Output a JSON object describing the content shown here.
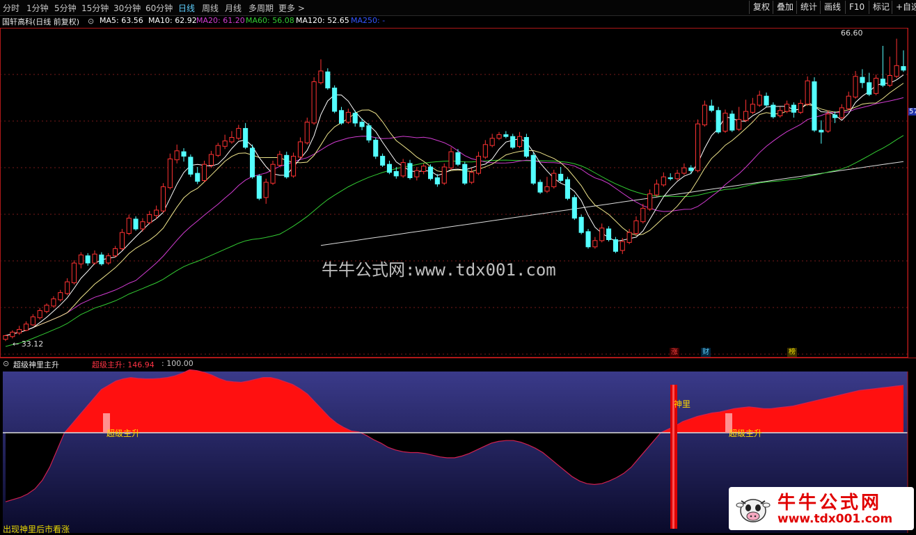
{
  "toolbar": {
    "periods": [
      "分时",
      "1分钟",
      "5分钟",
      "15分钟",
      "30分钟",
      "60分钟",
      "日线",
      "周线",
      "月线",
      "多周期",
      "更多 >"
    ],
    "active_period": "日线",
    "buttons": [
      "复权",
      "叠加",
      "统计",
      "画线",
      "F10",
      "标记",
      "+自选"
    ]
  },
  "stock": {
    "name": "国轩高科(日线 前复权)",
    "ma": [
      {
        "label": "MA5: 63.56",
        "color": "#ffffff"
      },
      {
        "label": "MA10: 62.92",
        "color": "#ffffff"
      },
      {
        "label": "MA20: 61.20",
        "color": "#d23cd2"
      },
      {
        "label": "MA60: 56.08",
        "color": "#33cc33"
      },
      {
        "label": "MA120: 52.65",
        "color": "#ffffff"
      },
      {
        "label": "MA250: -",
        "color": "#3355ff"
      }
    ],
    "high_label": "66.60",
    "low_label": "33.12",
    "price_axis_label": "57"
  },
  "colors": {
    "up": "#ff3232",
    "down": "#54ffff",
    "ma5": "#ffffff",
    "ma10": "#f0e68c",
    "ma20": "#d23cd2",
    "ma60": "#33cc33",
    "ma120": "#dddddd",
    "grid": "#7a1a1a",
    "frame": "#b01818"
  },
  "markers": [
    {
      "text": "涨",
      "color": "#ff4040"
    },
    {
      "text": "财",
      "color": "#5fd0ff"
    },
    {
      "text": "榜",
      "color": "#e8d800"
    }
  ],
  "indicator": {
    "name": "超级神里主升",
    "value_label": "超级主升: 146.94",
    "level_label": ": 100.00",
    "signal_label": "超级主升",
    "signal2_label": "超级主升",
    "shenli_label": "神里",
    "footer": "出现神里后市看涨"
  },
  "watermark": "牛牛公式网:www.tdx001.com",
  "logo": {
    "title": "牛牛公式网",
    "url": "www.tdx001.com"
  },
  "chart_data": {
    "type": "candlestick",
    "price_range": [
      33.12,
      66.6
    ],
    "candles": [
      [
        33.1,
        33.5,
        32.9,
        33.6
      ],
      [
        33.4,
        33.9,
        33.2,
        34.1
      ],
      [
        33.8,
        34.2,
        33.6,
        34.6
      ],
      [
        34.1,
        34.8,
        34.0,
        35.1
      ],
      [
        34.7,
        35.6,
        34.6,
        35.9
      ],
      [
        35.5,
        36.3,
        35.3,
        36.6
      ],
      [
        36.2,
        36.9,
        36.0,
        37.1
      ],
      [
        36.8,
        37.6,
        36.6,
        37.9
      ],
      [
        37.5,
        38.3,
        37.3,
        38.6
      ],
      [
        38.2,
        39.5,
        38.0,
        39.9
      ],
      [
        39.4,
        41.6,
        39.2,
        41.9
      ],
      [
        41.5,
        42.5,
        41.0,
        42.8
      ],
      [
        42.4,
        41.6,
        41.3,
        42.7
      ],
      [
        41.6,
        42.6,
        41.4,
        43.0
      ],
      [
        42.5,
        41.5,
        41.3,
        42.8
      ],
      [
        41.6,
        42.4,
        41.4,
        42.7
      ],
      [
        42.4,
        43.2,
        42.2,
        43.5
      ],
      [
        43.2,
        45.0,
        43.0,
        45.4
      ],
      [
        44.9,
        46.6,
        44.7,
        47.0
      ],
      [
        46.5,
        45.4,
        45.2,
        46.8
      ],
      [
        45.4,
        46.2,
        45.1,
        46.6
      ],
      [
        46.1,
        47.0,
        45.9,
        47.4
      ],
      [
        46.9,
        47.5,
        46.5,
        48.0
      ],
      [
        47.4,
        50.1,
        47.2,
        50.5
      ],
      [
        50.0,
        53.2,
        49.8,
        53.8
      ],
      [
        53.1,
        54.1,
        52.7,
        54.8
      ],
      [
        54.0,
        53.5,
        52.9,
        54.4
      ],
      [
        53.4,
        51.5,
        51.2,
        53.7
      ],
      [
        51.6,
        50.7,
        50.4,
        52.3
      ],
      [
        50.8,
        52.6,
        50.6,
        53.0
      ],
      [
        52.5,
        53.7,
        52.2,
        54.1
      ],
      [
        53.6,
        54.7,
        53.4,
        55.0
      ],
      [
        54.6,
        55.2,
        54.3,
        55.9
      ],
      [
        55.1,
        55.6,
        54.9,
        56.3
      ],
      [
        55.5,
        56.6,
        55.3,
        57.0
      ],
      [
        56.6,
        54.5,
        54.3,
        57.2
      ],
      [
        54.4,
        51.2,
        51.0,
        54.8
      ],
      [
        51.3,
        48.8,
        48.6,
        51.5
      ],
      [
        48.9,
        50.6,
        48.2,
        51.0
      ],
      [
        50.5,
        52.6,
        50.3,
        53.0
      ],
      [
        52.5,
        53.7,
        52.3,
        54.1
      ],
      [
        53.6,
        51.2,
        51.0,
        54.0
      ],
      [
        51.3,
        53.5,
        51.1,
        53.9
      ],
      [
        53.4,
        55.1,
        53.2,
        55.6
      ],
      [
        55.0,
        57.3,
        54.8,
        57.8
      ],
      [
        57.2,
        61.8,
        57.0,
        62.3
      ],
      [
        61.7,
        63.0,
        61.5,
        64.3
      ],
      [
        62.9,
        61.1,
        60.9,
        63.3
      ],
      [
        61.1,
        58.5,
        58.3,
        61.4
      ],
      [
        58.6,
        57.2,
        57.0,
        59.0
      ],
      [
        57.3,
        58.4,
        57.1,
        58.8
      ],
      [
        58.3,
        57.2,
        56.8,
        58.6
      ],
      [
        57.3,
        56.8,
        56.4,
        57.7
      ],
      [
        56.9,
        55.3,
        55.0,
        57.2
      ],
      [
        55.3,
        53.5,
        53.2,
        55.6
      ],
      [
        53.5,
        52.5,
        52.3,
        53.8
      ],
      [
        52.6,
        51.7,
        51.5,
        53.0
      ],
      [
        51.8,
        51.3,
        51.0,
        52.3
      ],
      [
        51.3,
        52.8,
        51.1,
        53.2
      ],
      [
        52.7,
        51.1,
        50.9,
        53.1
      ],
      [
        51.2,
        51.9,
        50.8,
        52.3
      ],
      [
        51.8,
        52.4,
        51.5,
        52.7
      ],
      [
        52.3,
        51.0,
        50.8,
        52.6
      ],
      [
        51.1,
        50.4,
        50.1,
        51.5
      ],
      [
        50.5,
        52.3,
        50.3,
        52.7
      ],
      [
        52.2,
        54.0,
        52.0,
        54.5
      ],
      [
        53.9,
        52.6,
        52.4,
        54.3
      ],
      [
        52.6,
        50.5,
        50.3,
        52.9
      ],
      [
        50.6,
        51.7,
        50.4,
        52.2
      ],
      [
        51.6,
        53.5,
        51.4,
        54.0
      ],
      [
        53.4,
        54.8,
        53.2,
        55.3
      ],
      [
        54.7,
        55.5,
        54.5,
        56.0
      ],
      [
        55.5,
        55.9,
        55.3,
        56.2
      ],
      [
        55.9,
        55.7,
        55.5,
        56.3
      ],
      [
        55.7,
        54.5,
        54.3,
        56.0
      ],
      [
        54.6,
        55.7,
        54.4,
        56.2
      ],
      [
        55.6,
        53.5,
        53.3,
        56.0
      ],
      [
        53.6,
        50.5,
        50.3,
        53.9
      ],
      [
        50.6,
        49.5,
        49.3,
        50.9
      ],
      [
        49.6,
        50.1,
        49.4,
        51.2
      ],
      [
        50.1,
        51.6,
        49.9,
        52.0
      ],
      [
        51.5,
        50.8,
        50.6,
        52.3
      ],
      [
        50.9,
        48.8,
        48.6,
        51.2
      ],
      [
        48.9,
        46.6,
        46.4,
        49.2
      ],
      [
        46.7,
        45.0,
        44.8,
        47.0
      ],
      [
        45.1,
        43.4,
        43.2,
        45.4
      ],
      [
        43.4,
        44.1,
        43.2,
        44.5
      ],
      [
        44.1,
        45.5,
        43.9,
        46.0
      ],
      [
        45.4,
        44.2,
        44.0,
        45.7
      ],
      [
        44.2,
        42.9,
        42.7,
        44.5
      ],
      [
        43.0,
        44.0,
        42.6,
        44.4
      ],
      [
        43.9,
        45.0,
        43.7,
        45.4
      ],
      [
        44.9,
        46.3,
        44.7,
        46.8
      ],
      [
        46.2,
        47.7,
        46.0,
        48.2
      ],
      [
        47.6,
        49.3,
        47.4,
        49.8
      ],
      [
        49.2,
        50.4,
        49.0,
        50.9
      ],
      [
        50.3,
        51.2,
        50.1,
        51.7
      ],
      [
        51.1,
        51.0,
        50.8,
        51.6
      ],
      [
        51.0,
        51.6,
        50.8,
        52.0
      ],
      [
        51.6,
        52.2,
        51.4,
        52.7
      ],
      [
        52.2,
        51.9,
        51.5,
        52.5
      ],
      [
        51.9,
        57.1,
        51.7,
        57.6
      ],
      [
        57.0,
        59.2,
        56.8,
        59.7
      ],
      [
        59.1,
        58.6,
        58.4,
        59.8
      ],
      [
        58.6,
        56.2,
        56.0,
        59.0
      ],
      [
        56.3,
        58.3,
        56.1,
        58.7
      ],
      [
        58.2,
        56.4,
        56.2,
        58.6
      ],
      [
        56.5,
        57.6,
        56.3,
        59.0
      ],
      [
        57.5,
        58.5,
        57.3,
        59.8
      ],
      [
        58.4,
        59.3,
        58.2,
        60.0
      ],
      [
        59.2,
        60.3,
        59.0,
        60.8
      ],
      [
        60.2,
        59.2,
        59.0,
        60.6
      ],
      [
        59.2,
        57.9,
        57.7,
        59.5
      ],
      [
        58.0,
        58.6,
        57.8,
        59.0
      ],
      [
        58.5,
        59.3,
        58.3,
        59.7
      ],
      [
        59.2,
        58.4,
        57.8,
        59.5
      ],
      [
        58.4,
        59.4,
        58.2,
        59.8
      ],
      [
        59.3,
        61.9,
        59.1,
        62.4
      ],
      [
        61.8,
        56.4,
        56.2,
        62.3
      ],
      [
        56.4,
        56.2,
        54.9,
        57.5
      ],
      [
        56.3,
        58.2,
        56.1,
        58.6
      ],
      [
        58.1,
        57.8,
        57.2,
        58.5
      ],
      [
        57.8,
        58.9,
        57.6,
        59.3
      ],
      [
        58.8,
        60.2,
        58.6,
        60.7
      ],
      [
        60.1,
        62.4,
        59.9,
        63.0
      ],
      [
        62.3,
        61.7,
        61.1,
        63.2
      ],
      [
        61.7,
        60.4,
        60.2,
        62.8
      ],
      [
        60.5,
        62.2,
        60.3,
        62.6
      ],
      [
        62.1,
        61.4,
        61.2,
        65.8
      ],
      [
        61.4,
        62.5,
        61.2,
        64.6
      ],
      [
        62.4,
        63.6,
        62.2,
        66.6
      ],
      [
        63.5,
        63.1,
        62.9,
        65.3
      ]
    ],
    "indicator_series": [
      -160,
      -155,
      -150,
      -142,
      -130,
      -110,
      -80,
      -40,
      0,
      20,
      40,
      60,
      80,
      100,
      110,
      120,
      125,
      128,
      126,
      125,
      125,
      126,
      128,
      132,
      138,
      146,
      144,
      140,
      134,
      126,
      120,
      118,
      117,
      120,
      124,
      128,
      128,
      124,
      118,
      112,
      102,
      90,
      72,
      54,
      36,
      22,
      12,
      4,
      2,
      -6,
      -16,
      -24,
      -34,
      -40,
      -44,
      -46,
      -46,
      -48,
      -52,
      -56,
      -58,
      -58,
      -54,
      -48,
      -40,
      -32,
      -24,
      -20,
      -18,
      -18,
      -22,
      -28,
      -36,
      -46,
      -60,
      -74,
      -88,
      -102,
      -112,
      -118,
      -120,
      -118,
      -112,
      -104,
      -94,
      -80,
      -60,
      -40,
      -20,
      0,
      8,
      16,
      26,
      32,
      38,
      42,
      46,
      48,
      52,
      56,
      58,
      60,
      58,
      56,
      56,
      58,
      60,
      62,
      66,
      70,
      74,
      78,
      82,
      86,
      90,
      94,
      98,
      100,
      102,
      104,
      106,
      108,
      110
    ],
    "signals": [
      "超级主升",
      "超级主升"
    ],
    "zero_level": 100.0
  }
}
